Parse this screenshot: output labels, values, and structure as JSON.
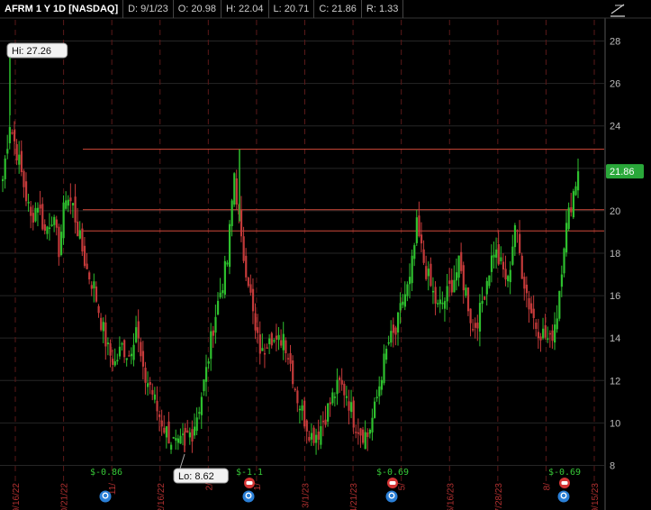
{
  "header": {
    "symbol": "AFRM 1 Y 1D [NASDAQ]",
    "date": "D: 9/1/23",
    "open": "O: 20.98",
    "high": "H: 22.04",
    "low": "L: 20.71",
    "close": "C: 21.86",
    "range": "R: 1.33"
  },
  "icons": {
    "drawing_tool": "trendline-tool-icon",
    "earnings_marker": "earnings-e-icon",
    "event_marker": "phone-icon"
  },
  "colors": {
    "up": "#2ec02e",
    "down": "#c43a3a",
    "level_line": "#d24a3a",
    "current_price_badge": "#2aa83a",
    "dividend_text": "#37c837",
    "earnings_icon": "#2a7fd6",
    "event_icon": "#d43434"
  },
  "chart_data": {
    "type": "candlestick",
    "y_range": [
      7,
      29
    ],
    "y_ticks": [
      "8",
      "10",
      "12",
      "14",
      "16",
      "18",
      "20",
      "22",
      "24",
      "26",
      "28"
    ],
    "x_tick_labels": [
      "9/16/22",
      "10/21/22",
      "11/",
      "12/16/22",
      "2/",
      "1/",
      "3/1/23",
      "4/21/23",
      "5/",
      "6/16/23",
      "7/28/23",
      "8/",
      "9/15/23"
    ],
    "grid": true,
    "horizontal_levels": [
      22.9,
      20.05,
      19.05
    ],
    "current_price": "21.86",
    "current_price_value": 21.86,
    "high_label": "Hi: 27.26",
    "low_label": "Lo: 8.62",
    "high_value": 27.26,
    "low_value": 8.62,
    "dividend_labels": [
      "$-0.86",
      "$-1.1",
      "$-0.69",
      "$-0.69"
    ],
    "close_path": [
      21.5,
      24.2,
      22.8,
      21.2,
      19.6,
      20.4,
      19.0,
      19.8,
      18.2,
      20.8,
      20.2,
      18.6,
      17.2,
      16.4,
      14.8,
      13.4,
      12.8,
      13.6,
      13.2,
      14.6,
      12.2,
      11.8,
      10.6,
      9.8,
      9.2,
      8.8,
      9.3,
      9.6,
      10.8,
      12.4,
      14.6,
      16.2,
      17.6,
      21.8,
      18.4,
      16.8,
      14.2,
      13.2,
      14.4,
      13.6,
      14.2,
      12.8,
      11.2,
      10.2,
      9.4,
      9.6,
      10.4,
      11.2,
      11.8,
      11.4,
      10.2,
      9.6,
      9.4,
      10.6,
      12.4,
      13.8,
      14.2,
      15.8,
      16.6,
      19.2,
      17.6,
      16.4,
      15.4,
      15.8,
      16.6,
      17.4,
      16.2,
      14.4,
      15.2,
      16.8,
      18.2,
      17.4,
      16.6,
      19.4,
      17.2,
      15.6,
      14.6,
      14.2,
      13.8,
      15.2,
      18.6,
      20.4,
      21.86
    ]
  }
}
